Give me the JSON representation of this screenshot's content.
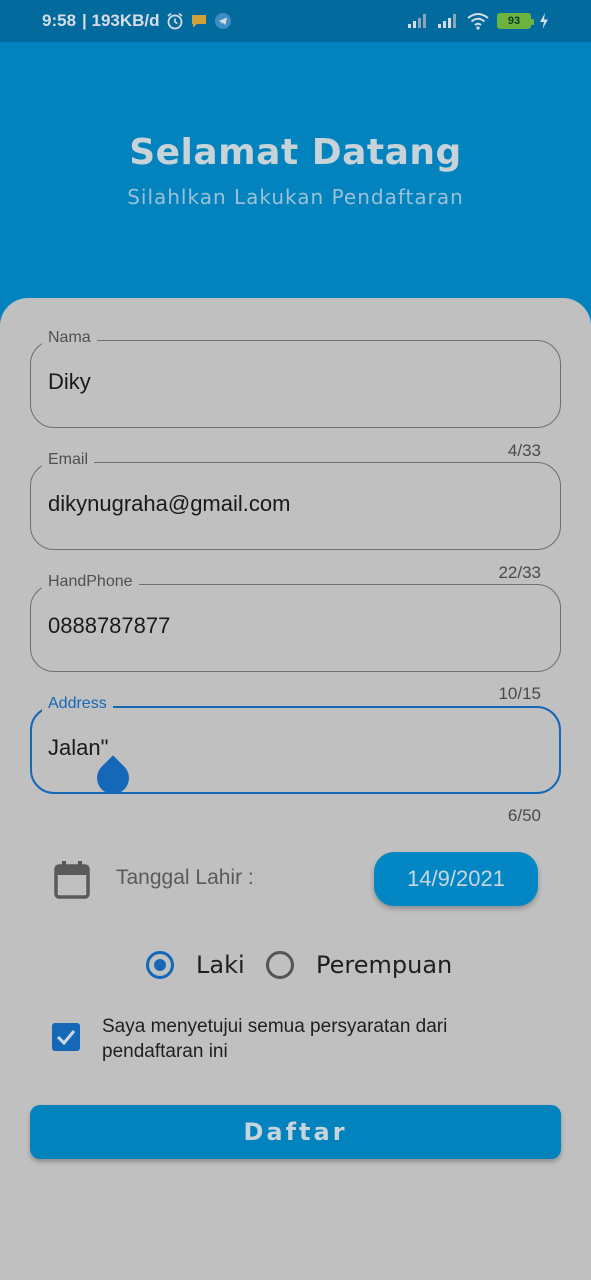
{
  "status_bar": {
    "time": "9:58",
    "network_speed": "| 193KB/d",
    "battery": "93",
    "icons": [
      "alarm-icon",
      "message-icon",
      "telegram-icon",
      "signal-icon",
      "signal-icon",
      "wifi-icon",
      "battery-icon",
      "charging-icon"
    ]
  },
  "header": {
    "title": "Selamat Datang",
    "subtitle": "Silahlkan Lakukan Pendaftaran",
    "color": "#0383bd"
  },
  "form": {
    "nama": {
      "label": "Nama",
      "value": "Diky",
      "counter": "4/33"
    },
    "email": {
      "label": "Email",
      "value": "dikynugraha@gmail.com",
      "counter": "22/33"
    },
    "handphone": {
      "label": "HandPhone",
      "value": "0888787877",
      "counter": "10/15"
    },
    "address": {
      "label": "Address",
      "value": "Jalan\"",
      "counter": "6/50"
    },
    "birth_date": {
      "label": "Tanggal Lahir :",
      "value": "14/9/2021"
    },
    "gender": {
      "options": [
        "Laki",
        "Perempuan"
      ],
      "selected": "Laki"
    },
    "agreement": {
      "text": "Saya menyetujui semua persyaratan dari pendaftaran ini",
      "checked": true
    },
    "submit_label": "Daftar"
  },
  "colors": {
    "accent": "#1568b8",
    "background": "#c0c0c0"
  }
}
